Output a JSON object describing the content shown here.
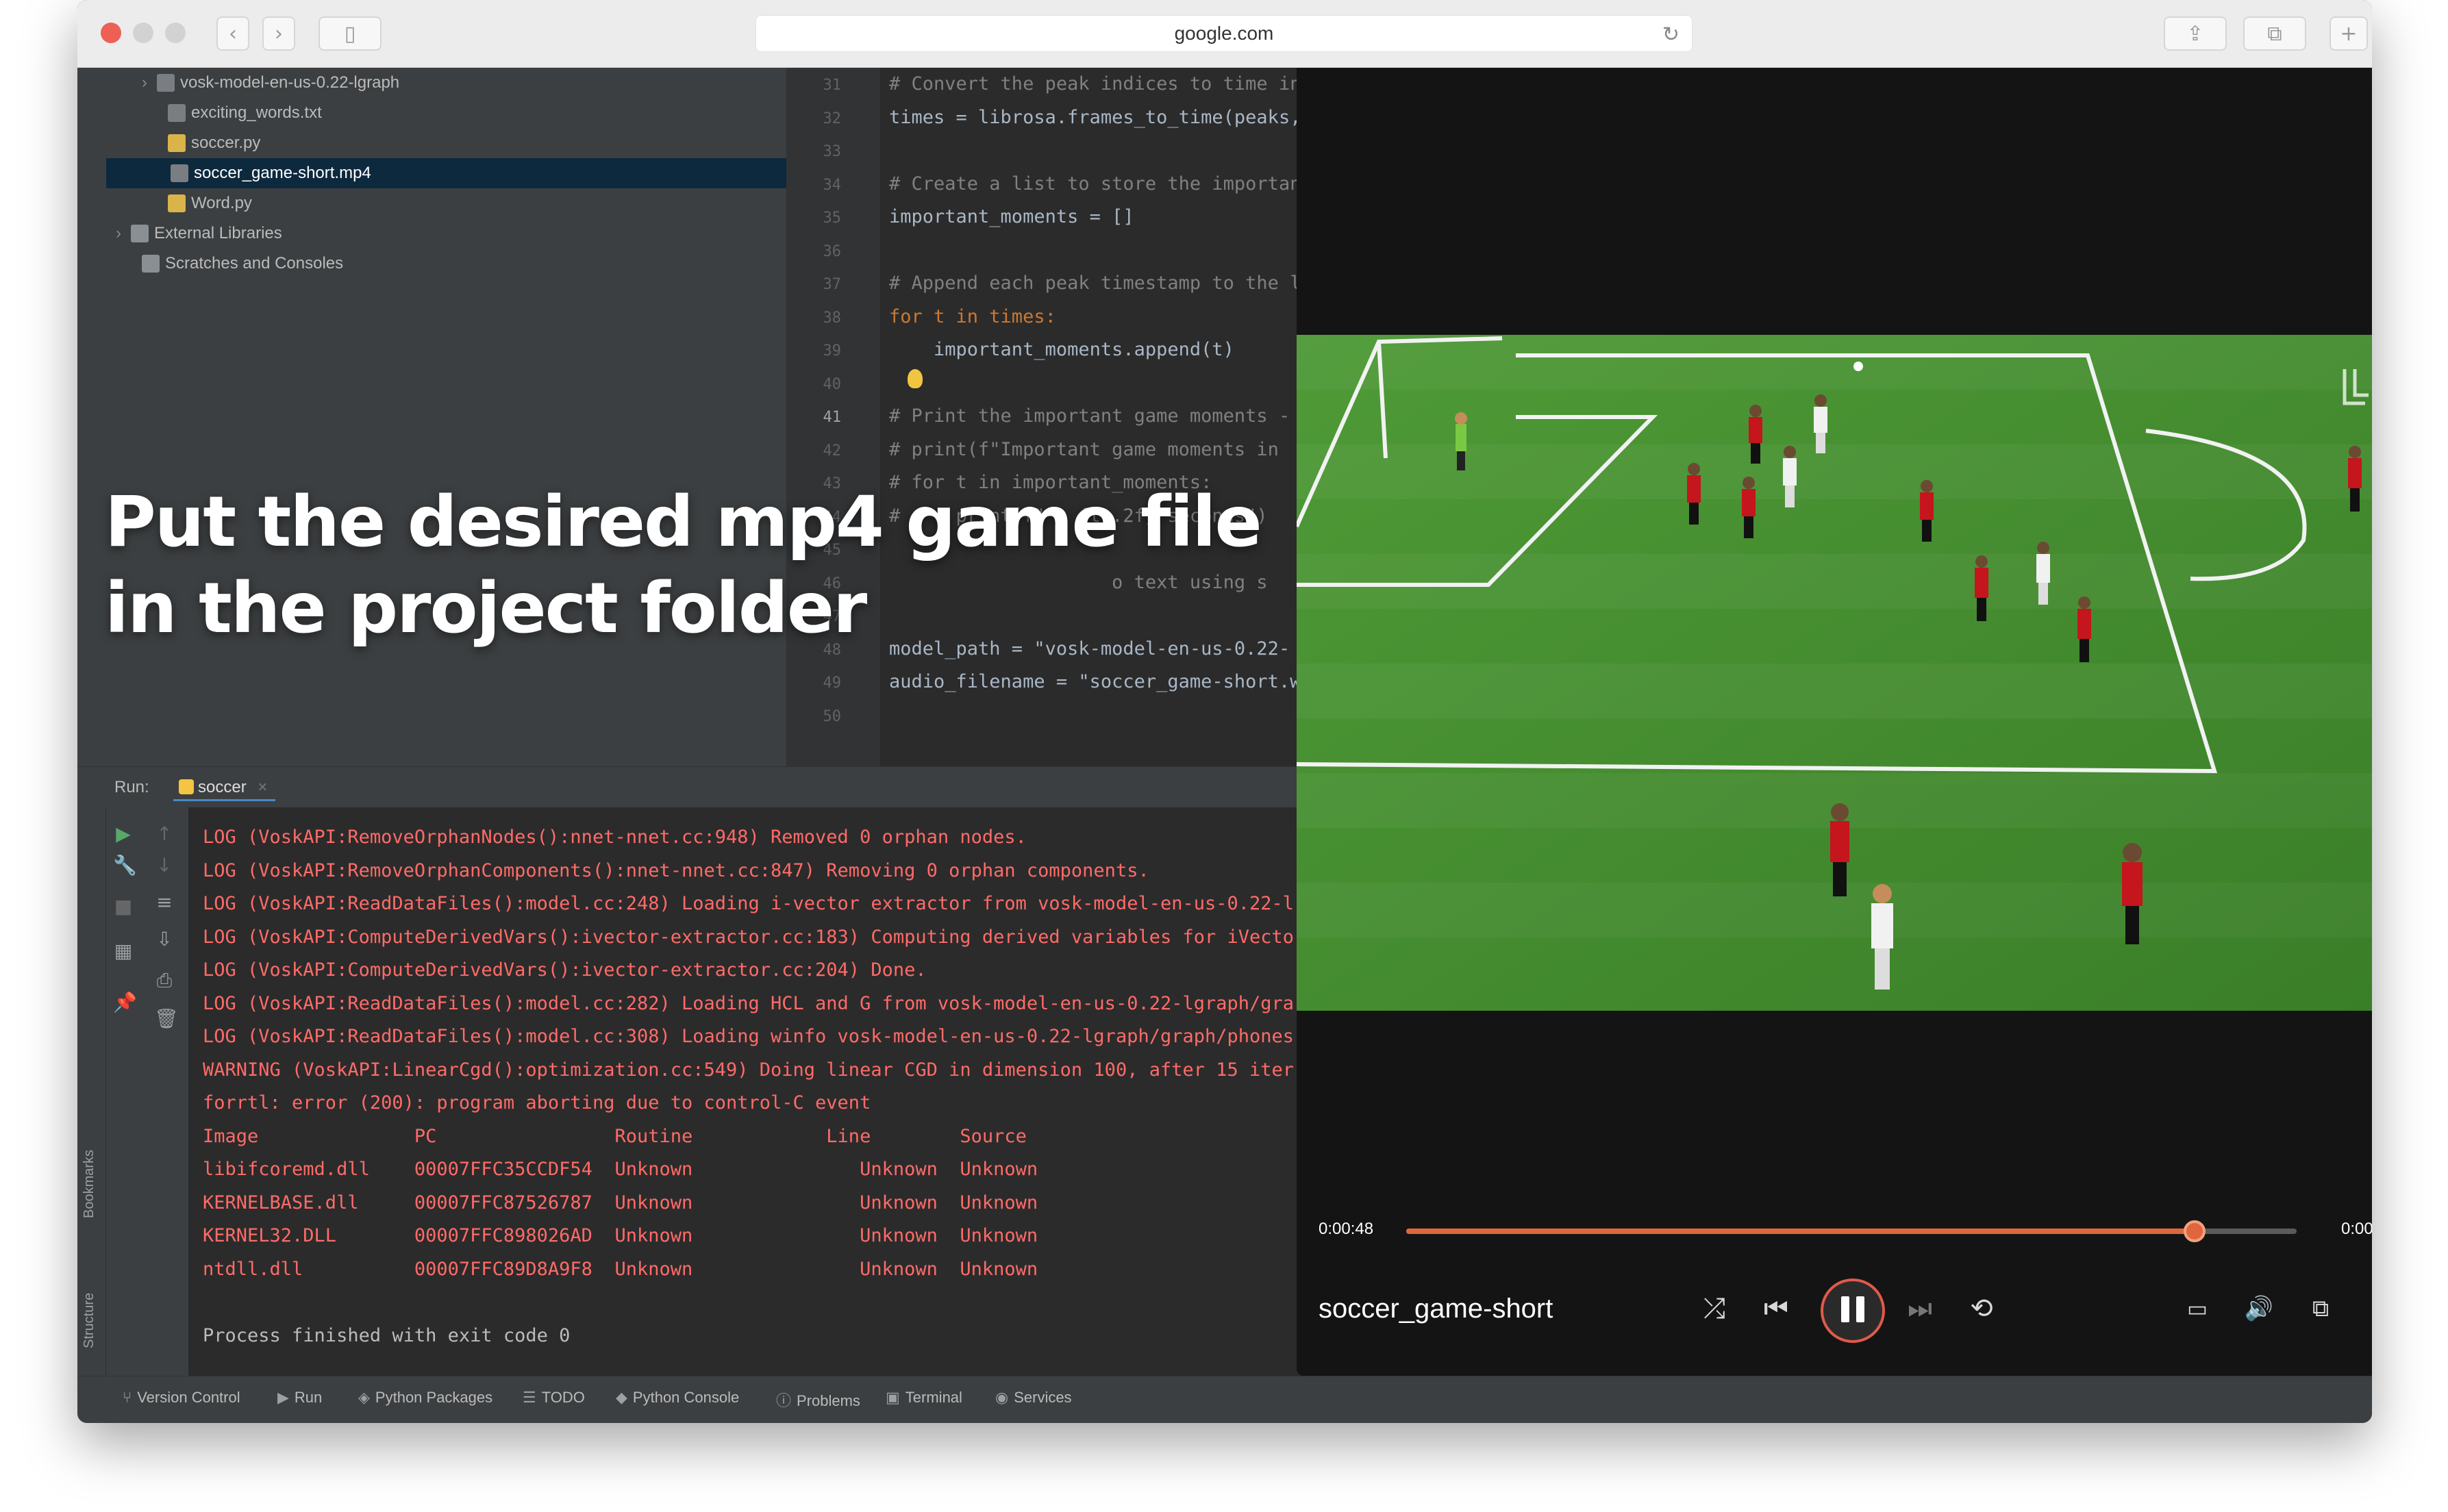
{
  "browser": {
    "url": "google.com"
  },
  "tree": {
    "items": [
      {
        "label": "vosk-model-en-us-0.22-lgraph",
        "type": "folder"
      },
      {
        "label": "exciting_words.txt",
        "type": "file"
      },
      {
        "label": "soccer.py",
        "type": "file"
      },
      {
        "label": "soccer_game-short.mp4",
        "type": "file",
        "selected": true
      },
      {
        "label": "Word.py",
        "type": "file"
      },
      {
        "label": "External Libraries",
        "type": "folder"
      },
      {
        "label": "Scratches and Consoles",
        "type": "folder"
      }
    ]
  },
  "overlay": {
    "line1": "Put the desired mp4 game file",
    "line2": "in the project folder"
  },
  "editor": {
    "lines": [
      {
        "n": "31",
        "text": "# Convert the peak indices to time in"
      },
      {
        "n": "32",
        "text": "times = librosa.frames_to_time(peaks,"
      },
      {
        "n": "33",
        "text": ""
      },
      {
        "n": "34",
        "text": "# Create a list to store the importan"
      },
      {
        "n": "35",
        "text": "important_moments = []"
      },
      {
        "n": "36",
        "text": ""
      },
      {
        "n": "37",
        "text": "# Append each peak timestamp to the l"
      },
      {
        "n": "38",
        "text": "for t in times:"
      },
      {
        "n": "39",
        "text": "    important_moments.append(t)"
      },
      {
        "n": "40",
        "text": ""
      },
      {
        "n": "41",
        "text": "# Print the important game moments -"
      },
      {
        "n": "42",
        "text": "# print(f\"Important game moments in"
      },
      {
        "n": "43",
        "text": "# for t in important_moments:"
      },
      {
        "n": "44",
        "text": "#     print(f\" - {t:.2f} seconds\")"
      },
      {
        "n": "45",
        "text": ""
      },
      {
        "n": "46",
        "text": "                    o text using s"
      },
      {
        "n": "47",
        "text": ""
      },
      {
        "n": "48",
        "text": "model_path = \"vosk-model-en-us-0.22-"
      },
      {
        "n": "49",
        "text": "audio_filename = \"soccer_game-short.w"
      },
      {
        "n": "50",
        "text": ""
      }
    ]
  },
  "run": {
    "label": "Run:",
    "tab": "soccer",
    "logs": [
      "LOG (VoskAPI:RemoveOrphanNodes():nnet-nnet.cc:948) Removed 0 orphan nodes.",
      "LOG (VoskAPI:RemoveOrphanComponents():nnet-nnet.cc:847) Removing 0 orphan components.",
      "LOG (VoskAPI:ReadDataFiles():model.cc:248) Loading i-vector extractor from vosk-model-en-us-0.22-l",
      "LOG (VoskAPI:ComputeDerivedVars():ivector-extractor.cc:183) Computing derived variables for iVecto",
      "LOG (VoskAPI:ComputeDerivedVars():ivector-extractor.cc:204) Done.",
      "LOG (VoskAPI:ReadDataFiles():model.cc:282) Loading HCL and G from vosk-model-en-us-0.22-lgraph/gra",
      "LOG (VoskAPI:ReadDataFiles():model.cc:308) Loading winfo vosk-model-en-us-0.22-lgraph/graph/phones",
      "WARNING (VoskAPI:LinearCgd():optimization.cc:549) Doing linear CGD in dimension 100, after 15 iter",
      "forrtl: error (200): program aborting due to control-C event",
      "Image              PC                Routine            Line        Source",
      "libifcoremd.dll    00007FFC35CCDF54  Unknown               Unknown  Unknown",
      "KERNELBASE.dll     00007FFC87526787  Unknown               Unknown  Unknown",
      "KERNEL32.DLL       00007FFC898026AD  Unknown               Unknown  Unknown",
      "ntdll.dll          00007FFC89D8A9F8  Unknown               Unknown  Unknown",
      "",
      "Process finished with exit code 0"
    ]
  },
  "sidebar_vertical": {
    "bookmarks": "Bookmarks",
    "structure": "Structure"
  },
  "statusbar": {
    "items": [
      "Version Control",
      "Run",
      "Python Packages",
      "TODO",
      "Python Console",
      "Problems",
      "Terminal",
      "Services"
    ]
  },
  "player": {
    "current_time": "0:00:48",
    "end_time": "0:00",
    "progress": 0.885,
    "title": "soccer_game-short",
    "accent": "#e0663e"
  }
}
